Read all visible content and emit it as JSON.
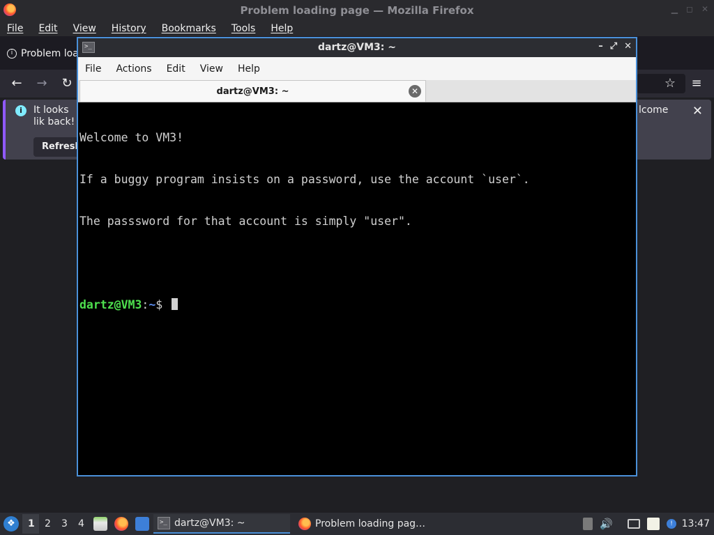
{
  "firefox": {
    "window_title": "Problem loading page — Mozilla Firefox",
    "menu": [
      "File",
      "Edit",
      "View",
      "History",
      "Bookmarks",
      "Tools",
      "Help"
    ],
    "tab_label": "Problem loa",
    "notice_text_left": "It looks lik back!",
    "notice_text_right": "lcome",
    "refresh_label": "Refresh"
  },
  "terminal": {
    "window_title": "dartz@VM3: ~",
    "menu": [
      "File",
      "Actions",
      "Edit",
      "View",
      "Help"
    ],
    "tab_label": "dartz@VM3: ~",
    "lines": [
      "Welcome to VM3!",
      "If a buggy program insists on a password, use the account `user`.",
      "The passsword for that account is simply \"user\".",
      ""
    ],
    "prompt": {
      "user_host": "dartz@VM3",
      "sep": ":",
      "path": "~",
      "symbol": "$ "
    }
  },
  "taskbar": {
    "workspaces": [
      "1",
      "2",
      "3",
      "4"
    ],
    "active_workspace": "1",
    "tasks": [
      {
        "label": "dartz@VM3: ~",
        "icon": "terminal-icon"
      },
      {
        "label": "Problem loading pag…",
        "icon": "firefox-icon"
      }
    ],
    "clock": "13:47"
  },
  "colors": {
    "accent": "#4a90d9",
    "prompt_user": "#4ee04e",
    "prompt_path": "#5b8def",
    "notice_accent": "#9059ff"
  }
}
